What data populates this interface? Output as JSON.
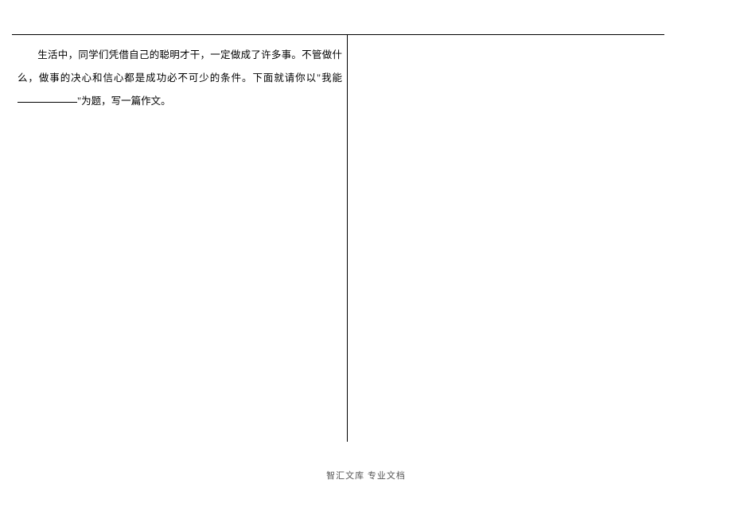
{
  "document": {
    "prompt_text_part1": "生活中，同学们凭借自己的聪明才干，一定做成了许多事。不管做什么，做事的决心和信心都是成功必不可少的条件。下面就请你以\"我能",
    "prompt_text_part2": "\"为题，写一篇作文。"
  },
  "footer": {
    "text": "智汇文库  专业文档"
  }
}
